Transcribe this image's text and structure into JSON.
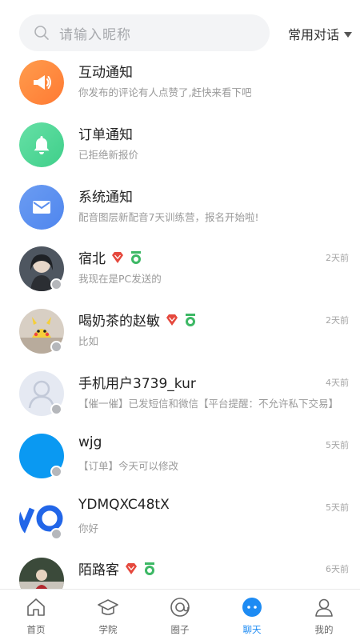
{
  "search": {
    "placeholder": "请输入昵称"
  },
  "filter": {
    "label": "常用对话"
  },
  "notices": [
    {
      "title": "互动通知",
      "preview": "你发布的评论有人点赞了,赶快来看下吧",
      "icon": "megaphone-icon",
      "color": "#ff8a3d"
    },
    {
      "title": "订单通知",
      "preview": "已拒绝新报价",
      "icon": "bell-icon",
      "color": "#4fd693"
    },
    {
      "title": "系统通知",
      "preview": "配音图层新配音7天训练营，报名开始啦!",
      "icon": "mail-icon",
      "color": "#5b8ff0"
    }
  ],
  "chats": [
    {
      "name": "宿北",
      "preview": "我现在是PC发送的",
      "time": "2天前",
      "badges": true
    },
    {
      "name": "喝奶茶的赵敏",
      "preview": "比如",
      "time": "2天前",
      "badges": true
    },
    {
      "name": "手机用户3739_kur",
      "preview": "【催一催】已发短信和微信【平台提醒：不允许私下交易】",
      "time": "4天前",
      "badges": false
    },
    {
      "name": "wjg",
      "preview": "【订单】今天可以修改",
      "time": "5天前",
      "badges": false
    },
    {
      "name": "YDMQXC48tX",
      "preview": "你好",
      "time": "5天前",
      "badges": false
    },
    {
      "name": "陌路客",
      "preview": "",
      "time": "6天前",
      "badges": true
    }
  ],
  "tabs": [
    {
      "label": "首页",
      "icon": "home-icon",
      "active": false
    },
    {
      "label": "学院",
      "icon": "graduation-cap-icon",
      "active": false
    },
    {
      "label": "圈子",
      "icon": "at-circle-icon",
      "active": false
    },
    {
      "label": "聊天",
      "icon": "chat-bubble-icon",
      "active": true
    },
    {
      "label": "我的",
      "icon": "user-icon",
      "active": false
    }
  ],
  "colors": {
    "accent": "#1d8bf3",
    "vip": "#e5483d",
    "medal": "#3db865"
  }
}
